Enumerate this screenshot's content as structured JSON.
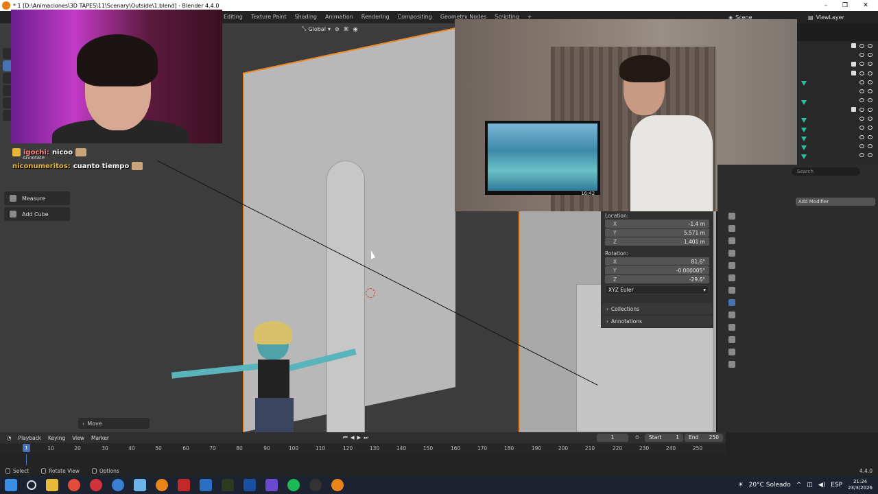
{
  "window": {
    "title": "* 1 [D:\\Animaciones\\3D TAPES\\11\\Scenary\\Outside\\1.blend] - Blender 4.4.0"
  },
  "workspace_tabs": [
    "Editing",
    "Texture Paint",
    "Shading",
    "Animation",
    "Rendering",
    "Compositing",
    "Geometry Nodes",
    "Scripting"
  ],
  "scene": {
    "label": "Scene",
    "view_layer": "ViewLayer"
  },
  "viewport_header": {
    "transform_orientation": "Global"
  },
  "tools": {
    "annotate": "Annotate",
    "measure": "Measure",
    "add_cube": "Add Cube"
  },
  "last_operator": "Move",
  "chat": [
    {
      "user": "igochi:",
      "message": "nicoo"
    },
    {
      "user": "niconumeritos:",
      "message": "cuanto tiempo"
    }
  ],
  "webcam2": {
    "tv_time": "16:42"
  },
  "properties": {
    "search_placeholder": "Search",
    "add_modifier": "Add Modifier"
  },
  "transform": {
    "location_label": "Location:",
    "location": [
      {
        "axis": "X",
        "value": "-1.4 m"
      },
      {
        "axis": "Y",
        "value": "5.571 m"
      },
      {
        "axis": "Z",
        "value": "1.401 m"
      }
    ],
    "rotation_label": "Rotation:",
    "rotation": [
      {
        "axis": "X",
        "value": "81.6°"
      },
      {
        "axis": "Y",
        "value": "-0.000005°"
      },
      {
        "axis": "Z",
        "value": "-29.6°"
      }
    ],
    "rotation_mode": "XYZ Euler"
  },
  "panels": {
    "collections": "Collections",
    "annotations": "Annotations"
  },
  "timeline": {
    "playback": "Playback",
    "keying": "Keying",
    "view": "View",
    "marker": "Marker",
    "current_frame": "1",
    "start_label": "Start",
    "start": "1",
    "end_label": "End",
    "end": "250",
    "playhead_frame": "1",
    "ticks": [
      "10",
      "20",
      "30",
      "40",
      "50",
      "60",
      "70",
      "80",
      "90",
      "100",
      "110",
      "120",
      "130",
      "140",
      "150",
      "160",
      "170",
      "180",
      "190",
      "200",
      "210",
      "220",
      "230",
      "240",
      "250"
    ]
  },
  "statusbar": {
    "select": "Select",
    "rotate_view": "Rotate View",
    "options": "Options",
    "version": "4.4.0"
  },
  "taskbar": {
    "weather": "20°C  Soleado",
    "language": "ESP",
    "time": "21:24",
    "date": "23/3/2026"
  }
}
